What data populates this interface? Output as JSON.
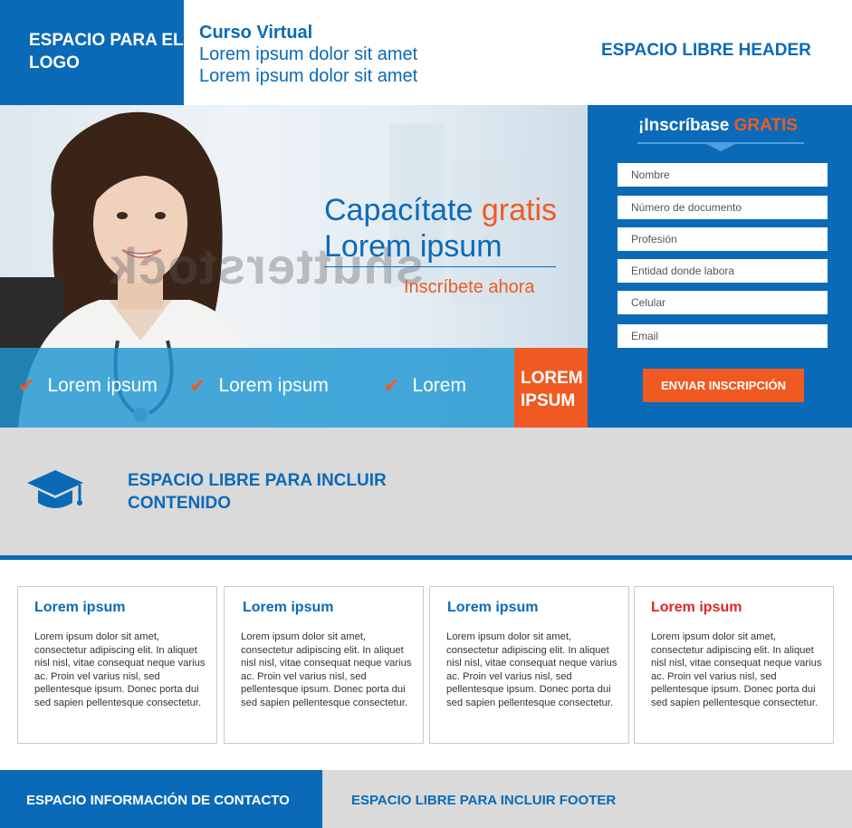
{
  "header": {
    "logo_text": "ESPACIO PARA EL LOGO",
    "course_title": "Curso Virtual",
    "course_line1": "Lorem ipsum dolor sit amet",
    "course_line2": "Lorem ipsum dolor sit amet",
    "free_space": "ESPACIO LIBRE HEADER"
  },
  "hero": {
    "title_part1": "Capacítate ",
    "title_accent": "gratis",
    "title_line2": "Lorem ipsum",
    "cta": "Inscríbete ahora",
    "watermark": "shutterstock",
    "features": [
      "Lorem ipsum",
      "Lorem ipsum",
      "Lorem"
    ],
    "highlight": "LOREM IPSUM"
  },
  "form": {
    "title_part1": "¡Inscríbase ",
    "title_accent": "GRATIS",
    "fields": [
      "Nombre",
      "Número de documento",
      "Profesión",
      "Entidad donde labora",
      "Celular",
      "Email"
    ],
    "submit_label": "ENVIAR INSCRIPCIÓN"
  },
  "band": {
    "icon": "graduation-cap-icon",
    "text": "ESPACIO LIBRE PARA INCLUIR CONTENIDO"
  },
  "cards": [
    {
      "title": "Lorem ipsum",
      "body": "Lorem ipsum dolor sit amet, consectetur adipiscing elit. In aliquet nisl nisl, vitae consequat neque varius ac. Proin vel varius nisl, sed pellentesque ipsum. Donec porta dui sed sapien pellentesque consectetur."
    },
    {
      "title": "Lorem ipsum",
      "body": "Lorem ipsum dolor sit amet, consectetur adipiscing elit. In aliquet nisl nisl, vitae consequat neque varius ac. Proin vel varius nisl, sed pellentesque ipsum. Donec porta dui sed sapien pellentesque consectetur."
    },
    {
      "title": "Lorem ipsum",
      "body": "Lorem ipsum dolor sit amet, consectetur adipiscing elit. In aliquet nisl nisl, vitae consequat neque varius ac. Proin vel varius nisl, sed pellentesque ipsum. Donec porta dui sed sapien pellentesque consectetur."
    },
    {
      "title": "Lorem ipsum",
      "body": "Lorem ipsum dolor sit amet, consectetur adipiscing elit. In aliquet nisl nisl, vitae consequat neque varius ac. Proin vel varius nisl, sed pellentesque ipsum. Donec porta dui sed sapien pellentesque consectetur."
    }
  ],
  "footer": {
    "contact": "ESPACIO INFORMACIÓN DE CONTACTO",
    "free_space": "ESPACIO LIBRE PARA INCLUIR FOOTER"
  },
  "colors": {
    "primary_blue": "#0a6ab8",
    "accent_orange": "#f05a22",
    "light_blue": "#1e96d2",
    "gray_band": "#dadada",
    "last_card_title": "#e0262c"
  }
}
